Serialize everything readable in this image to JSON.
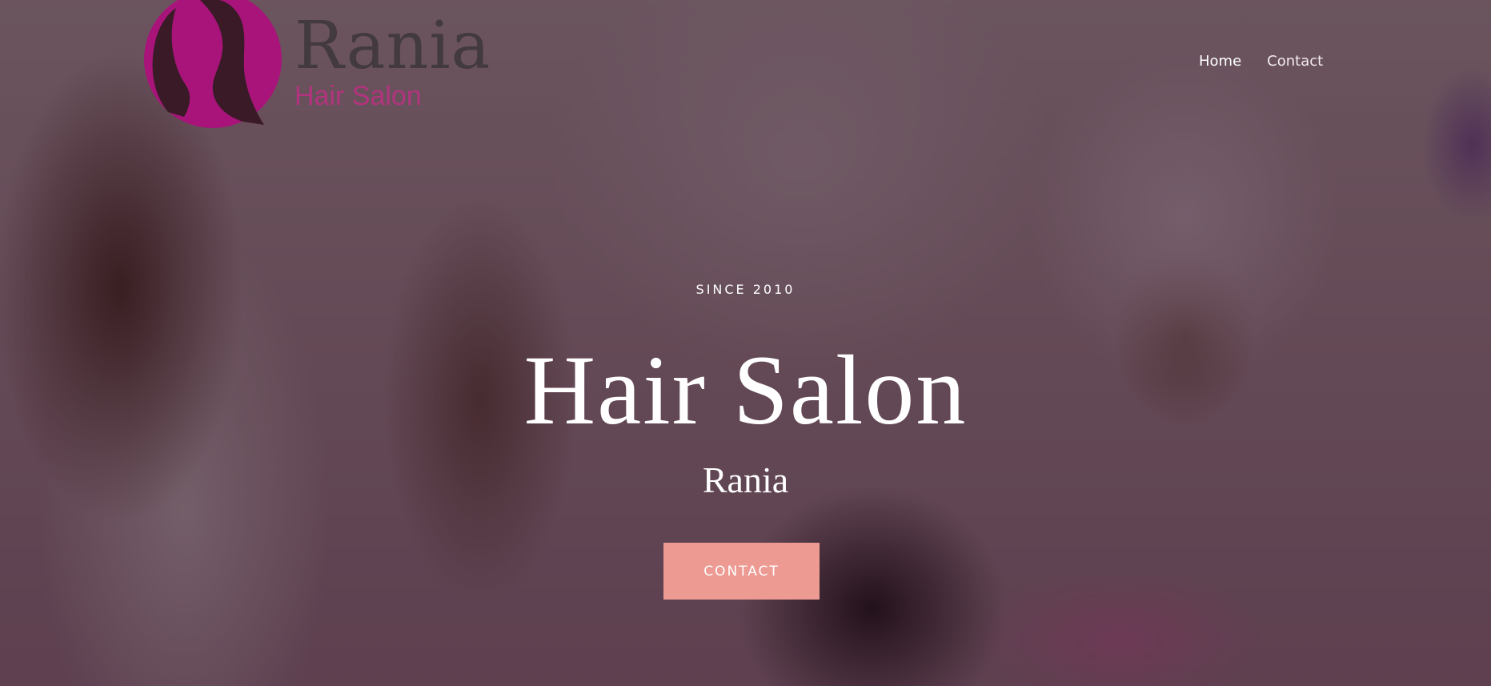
{
  "header": {
    "brand_name": "Rania",
    "brand_subtitle": "Hair Salon",
    "logo_icon": "woman-silhouette-icon",
    "logo_color": "#a8147a"
  },
  "nav": {
    "items": [
      {
        "label": "Home",
        "active": true
      },
      {
        "label": "Contact",
        "active": false
      }
    ]
  },
  "hero": {
    "eyebrow": "SINCE 2010",
    "title": "Hair Salon",
    "subtitle": "Rania",
    "cta_label": "CONTACT",
    "cta_color": "#ec9a92"
  }
}
